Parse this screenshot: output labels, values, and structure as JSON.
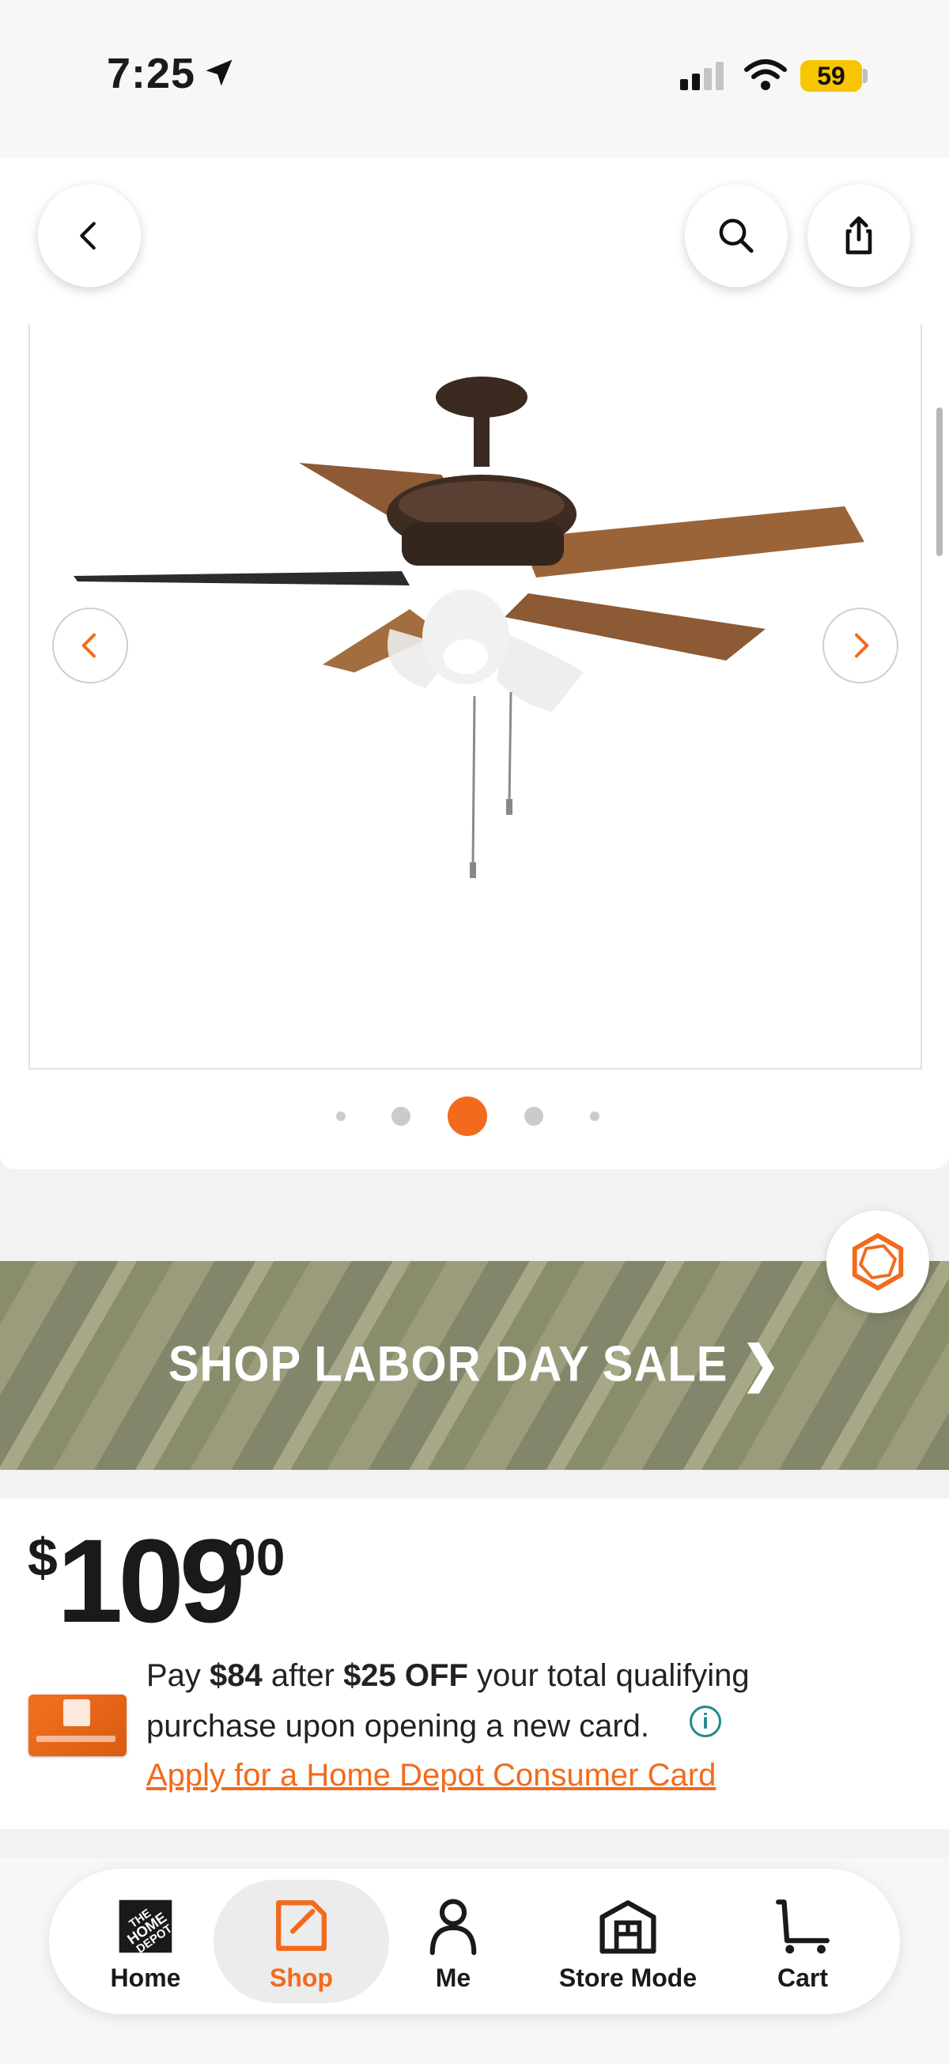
{
  "status_bar": {
    "time": "7:25",
    "battery": "59"
  },
  "header": {
    "back_icon": "chevron-left-icon",
    "search_icon": "search-icon",
    "share_icon": "share-icon"
  },
  "gallery": {
    "total_images": 5,
    "active_index": 2
  },
  "promo_banner": {
    "text": "SHOP LABOR DAY SALE ❯"
  },
  "price": {
    "currency": "$",
    "dollars": "109",
    "cents": "00"
  },
  "financing": {
    "pay_prefix": "Pay ",
    "pay_amount": "$84",
    "after": " after ",
    "discount": "$25 OFF",
    "rest_line1": " your total qualifying",
    "line2": "purchase upon opening a new card.",
    "apply_link": "Apply for a Home Depot Consumer Card"
  },
  "bottom_nav": {
    "items": [
      {
        "label": "Home",
        "icon": "home-depot-logo-icon"
      },
      {
        "label": "Shop",
        "icon": "shop-tag-icon",
        "active": true
      },
      {
        "label": "Me",
        "icon": "person-icon"
      },
      {
        "label": "Store Mode",
        "icon": "store-icon"
      },
      {
        "label": "Cart",
        "icon": "cart-icon"
      }
    ]
  },
  "colors": {
    "accent": "#f26b1d",
    "banner": "#8a8d6c",
    "info": "#1f8a8a"
  }
}
